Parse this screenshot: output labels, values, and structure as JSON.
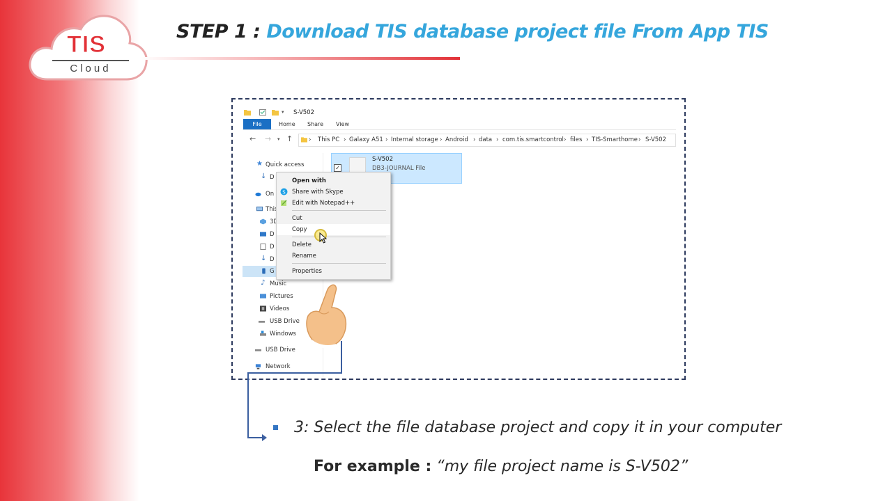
{
  "logo": {
    "brand": "TIS",
    "subtitle": "Cloud"
  },
  "slide": {
    "step_prefix": "STEP 1 : ",
    "step_title": "Download TIS database project file From App TIS"
  },
  "explorer": {
    "window_title": "S-V502",
    "ribbon_tabs": {
      "file": "File",
      "home": "Home",
      "share": "Share",
      "view": "View"
    },
    "breadcrumb": [
      "This PC",
      "Galaxy A51",
      "Internal storage",
      "Android",
      "data",
      "com.tis.smartcontrol",
      "files",
      "TIS-Smarthome",
      "S-V502"
    ],
    "nav": {
      "quick_access": "Quick access",
      "downloads": "D",
      "onedrive": "On",
      "this_pc": "This",
      "objects3d": "3D",
      "desktop": "D",
      "documents": "D",
      "downloads2": "D",
      "galaxy": "G",
      "music": "Music",
      "pictures": "Pictures",
      "videos": "Videos",
      "usb_drive_1": "USB Drive",
      "windows": "Windows",
      "usb_drive_2": "USB Drive",
      "network": "Network"
    },
    "file": {
      "name": "S-V502",
      "type": "DB3-JOURNAL File"
    },
    "context_menu": {
      "open_with": "Open with",
      "share_skype": "Share with Skype",
      "edit_notepad": "Edit with Notepad++",
      "cut": "Cut",
      "copy": "Copy",
      "delete": "Delete",
      "rename": "Rename",
      "properties": "Properties"
    }
  },
  "instruction": {
    "text": "3: Select the file database project and copy it in your computer",
    "example_label": "For example :",
    "example_value": " “my file project name is S-V502”"
  },
  "colors": {
    "brand_red": "#e23137",
    "title_blue": "#35a6dc",
    "frame": "#2d3a5e",
    "bullet": "#3576c3"
  }
}
